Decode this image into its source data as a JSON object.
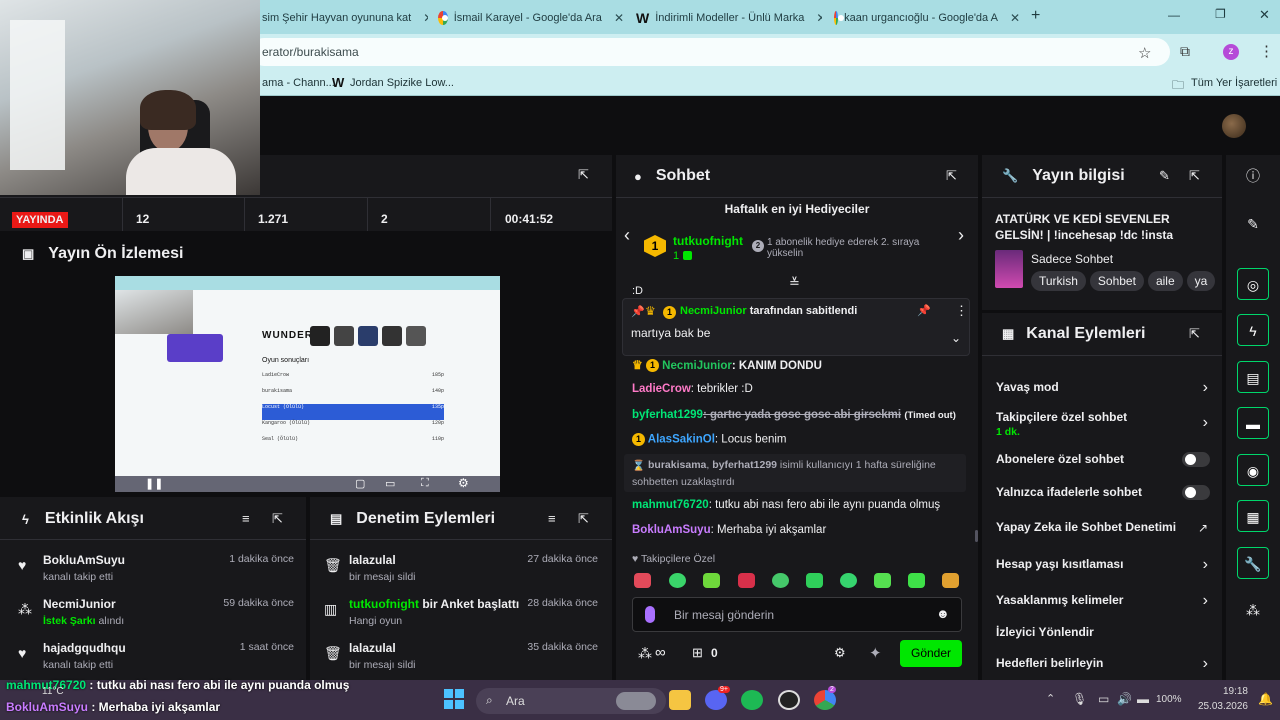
{
  "browser": {
    "tabs": [
      {
        "label": "sim Şehir Hayvan oyununa kat"
      },
      {
        "label": "İsmail Karayel - Google'da Ara"
      },
      {
        "label": "İndirimli Modeller - Ünlü Marka"
      },
      {
        "label": "kaan urgancıoğlu - Google'da A"
      }
    ],
    "new_tab": "+",
    "url": "erator/burakisama",
    "bookmarks": [
      {
        "label": "ama - Chann..."
      },
      {
        "label": "Jordan Spizike Low..."
      }
    ],
    "all_bookmarks": "Tüm Yer İşaretleri",
    "profile_initial": "z"
  },
  "stats": {
    "live_label": "YAYINDA",
    "viewers": "12",
    "followers": "1.271",
    "other": "2",
    "uptime": "00:41:52"
  },
  "preview": {
    "title": "Yayın Ön İzlemesi",
    "thumb": {
      "logo": "WUNDER",
      "heading": "Oyun sonuçları",
      "rows": [
        "LadieCrow",
        "burakisama",
        "Locust (Ölülü)",
        "Kangaroo (Ölülü)",
        "Seal (Ölülü)"
      ],
      "scores": [
        "185p",
        "140p",
        "135p",
        "120p",
        "110p"
      ]
    }
  },
  "activity": {
    "title": "Etkinlik Akışı",
    "items": [
      {
        "name": "BokluAmSuyu",
        "sub": "kanalı takip etti",
        "time": "1 dakika önce"
      },
      {
        "name": "NecmiJunior",
        "sub_hl": "İstek Şarkı",
        "sub_rest": " alındı",
        "time": "59 dakika önce"
      },
      {
        "name": "hajadgqudhqu",
        "sub": "kanalı takip etti",
        "time": "1 saat önce"
      }
    ]
  },
  "moderation": {
    "title": "Denetim Eylemleri",
    "items": [
      {
        "name": "lalazulal",
        "sub": "bir mesajı sildi",
        "time": "27 dakika önce"
      },
      {
        "name_hl": "tutkuofnight",
        "name_rest": " bir Anket başlattı",
        "sub": "Hangi oyun",
        "time": "28 dakika önce"
      },
      {
        "name": "lalazulal",
        "sub": "bir mesajı sildi",
        "time": "35 dakika önce"
      }
    ]
  },
  "chat": {
    "title": "Sohbet",
    "gifters_title": "Haftalık en iyi Hediyeciler",
    "top_gifter": "tutkuofnight",
    "top_gifter_count": "1",
    "gifter_rank": "1",
    "next_rank": "2",
    "gifter_prompt": "1 abonelik hediye ederek 2. sıraya yükselin",
    "partial_line": ":D",
    "pinned_by_user": "NecmiJunior",
    "pinned_by_suffix": " tarafından sabitlendi",
    "pinned_text": "martıya bak be",
    "messages": [
      {
        "user": "NecmiJunior",
        "text": ": KANIM DONDU",
        "color": "#22c55e"
      },
      {
        "user": "LadieCrow",
        "text": ": tebrikler :D",
        "color": "#ff7ac8"
      },
      {
        "user": "byferhat1299",
        "text": ": gartıc yada gose gose abi girsekmi",
        "color": "#00e676",
        "note": "(Timed out)"
      },
      {
        "user": "AlasSakinOl",
        "text": ": Locus benim",
        "color": "#3ea6ff"
      },
      {
        "user": "mahmut76720",
        "text": ": tutku abi nası fero abi ile aynı puanda olmuş",
        "color": "#00e676"
      },
      {
        "user": "BokluAmSuyu",
        "text": ": Merhaba iyi akşamlar",
        "color": "#c97cff"
      }
    ],
    "system_msg": {
      "mod": "burakisama",
      "target": "byferhat1299",
      "text1": " isimli kullanıcıyı 1 hafta süreliğine",
      "text2": "sohbetten uzaklaştırdı"
    },
    "followers_only": "Takipçilere Özel",
    "input_placeholder": "Bir mesaj gönderin",
    "infinity": "∞",
    "gift_count": "0",
    "send_label": "Gönder"
  },
  "stream_info": {
    "title": "Yayın bilgisi",
    "stream_title": "ATATÜRK VE KEDİ SEVENLER GELSİN! | !incehesap !dc !insta",
    "category": "Sadece Sohbet",
    "tags": [
      "Turkish",
      "Sohbet",
      "aile",
      "ya"
    ]
  },
  "channel_actions": {
    "title": "Kanal Eylemleri",
    "items": [
      {
        "label": "Yavaş mod",
        "kind": "chevron"
      },
      {
        "label": "Takipçilere özel sohbet",
        "sub": "1 dk.",
        "kind": "chevron"
      },
      {
        "label": "Abonelere özel sohbet",
        "kind": "toggle"
      },
      {
        "label": "Yalnızca ifadelerle sohbet",
        "kind": "toggle"
      },
      {
        "label": "Yapay Zeka ile Sohbet Denetimi",
        "kind": "external"
      },
      {
        "label": "Hesap yaşı kısıtlaması",
        "kind": "chevron"
      },
      {
        "label": "Yasaklanmış kelimeler",
        "kind": "chevron"
      },
      {
        "label": "İzleyici Yönlendir",
        "kind": "none"
      },
      {
        "label": "Hedefleri belirleyin",
        "kind": "chevron"
      }
    ]
  },
  "overlay": {
    "line1_user": "mahmut76720",
    "line1_text": " : tutku abi nası fero abi ile aynı puanda olmuş",
    "line2_user": "BokluAmSuyu",
    "line2_text": " : Merhaba iyi akşamlar"
  },
  "taskbar": {
    "weather": "11°C",
    "search": "Ara",
    "battery": "100%",
    "time": "19:18",
    "date": "25.03.2026",
    "discord_badge": "9+",
    "chrome_badge": "2"
  },
  "colors": {
    "accent": "#00e701",
    "panel": "#18181b",
    "bg": "#0e0e10",
    "live": "#e91916",
    "tabbar": "#a9dde3"
  }
}
